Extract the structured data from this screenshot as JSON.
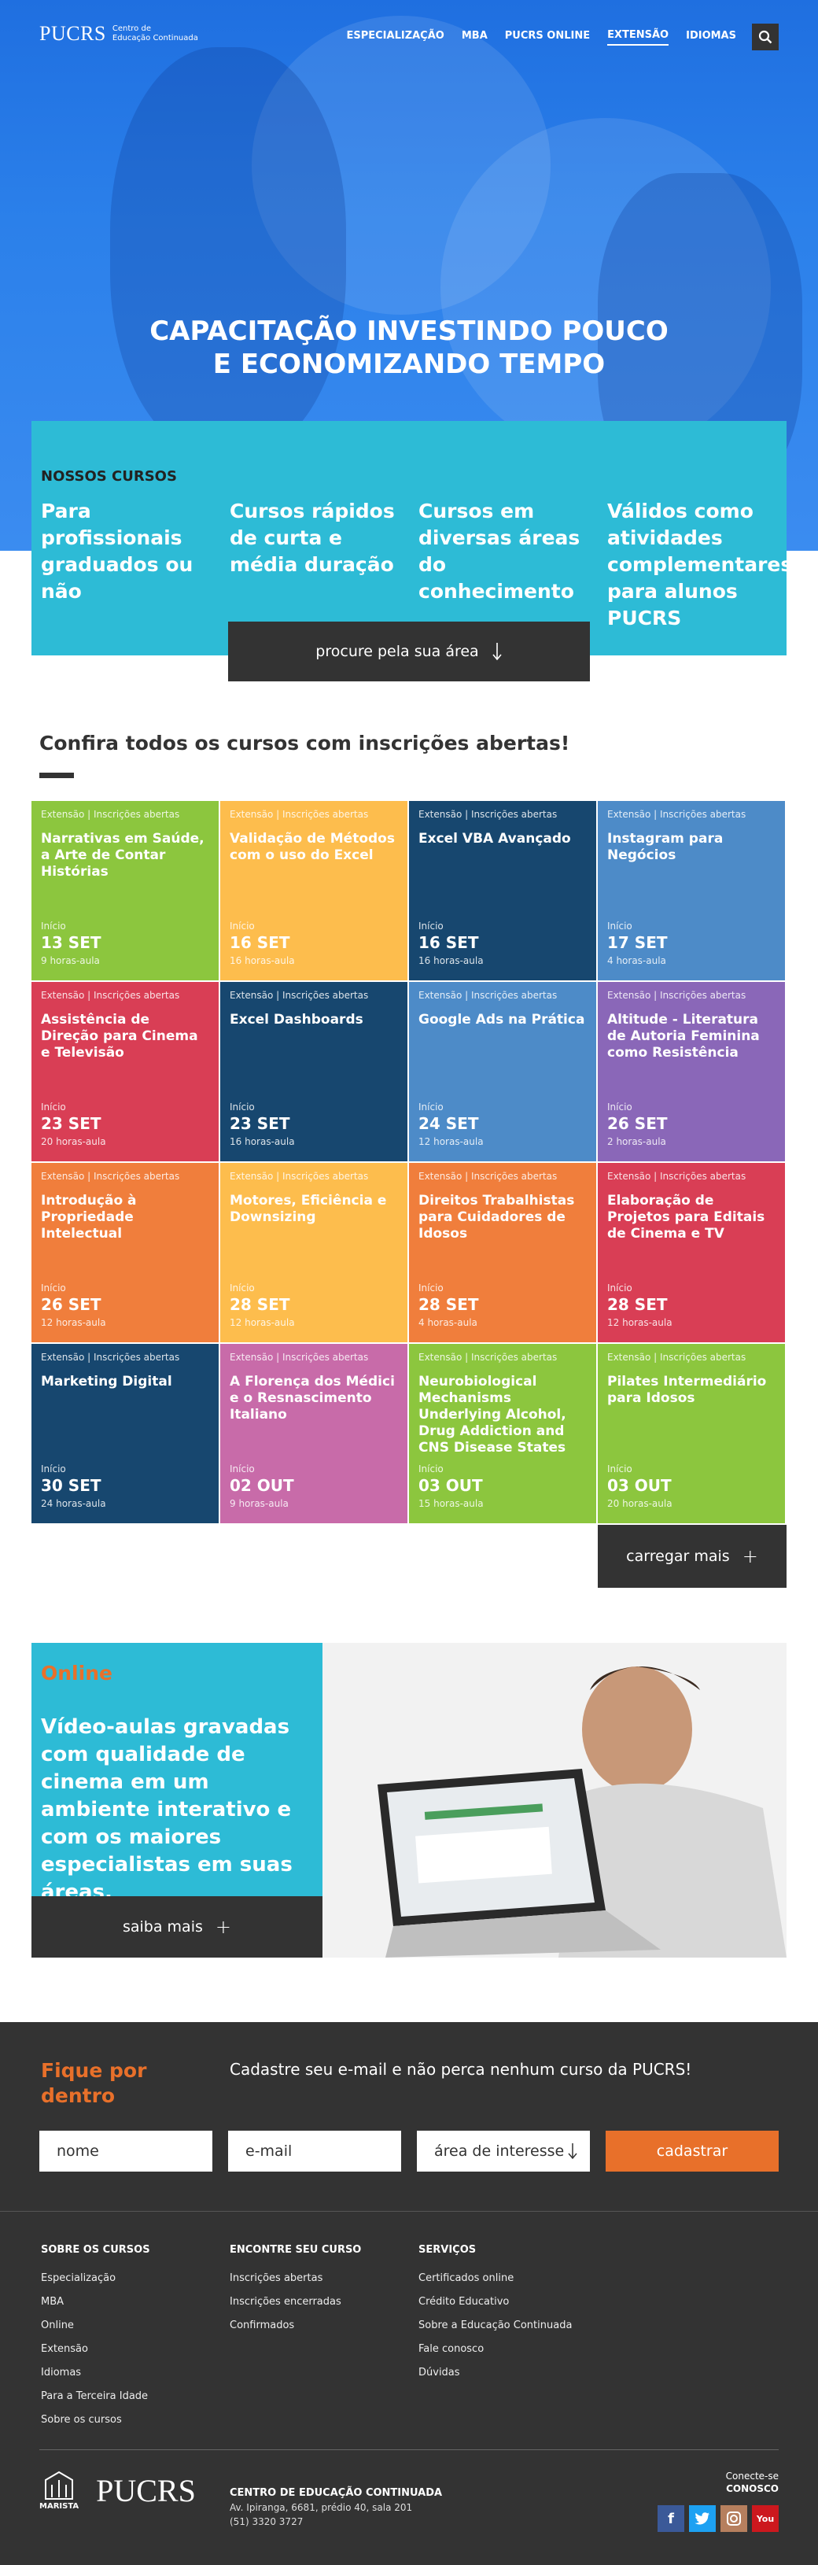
{
  "brand": {
    "name": "PUCRS",
    "sub1": "Centro de",
    "sub2": "Educação Continuada"
  },
  "nav": [
    "ESPECIALIZAÇÃO",
    "MBA",
    "PUCRS ONLINE",
    "EXTENSÃO",
    "IDIOMAS"
  ],
  "hero": {
    "line1": "CAPACITAÇÃO INVESTINDO POUCO",
    "line2": "E ECONOMIZANDO TEMPO"
  },
  "courses_box": {
    "label": "NOSSOS CURSOS",
    "columns": [
      "Para profissionais graduados ou não",
      "Cursos rápidos de curta e média duração",
      "Cursos em diversas áreas do conhecimento",
      "Válidos como atividades complementares para alunos PUCRS"
    ],
    "button": "procure pela sua área"
  },
  "section_title": "Confira todos os cursos com inscrições abertas!",
  "cards": [
    {
      "tag": "Extensão | Inscrições abertas",
      "title": "Narrativas em Saúde, a Arte de Contar Histórias",
      "inicio": "Início",
      "date": "13 SET",
      "hours": "9 horas-aula",
      "color": "#8cc63e"
    },
    {
      "tag": "Extensão | Inscrições abertas",
      "title": "Validação de Métodos com o uso do Excel",
      "inicio": "Início",
      "date": "16 SET",
      "hours": "16 horas-aula",
      "color": "#fdbd4d"
    },
    {
      "tag": "Extensão | Inscrições abertas",
      "title": "Excel VBA Avançado",
      "inicio": "Início",
      "date": "16 SET",
      "hours": "16 horas-aula",
      "color": "#17476f"
    },
    {
      "tag": "Extensão | Inscrições abertas",
      "title": "Instagram para Negócios",
      "inicio": "Início",
      "date": "17 SET",
      "hours": "4 horas-aula",
      "color": "#4d8bc8"
    },
    {
      "tag": "Extensão | Inscrições abertas",
      "title": "Assistência de Direção para Cinema e Televisão",
      "inicio": "Início",
      "date": "23 SET",
      "hours": "20 horas-aula",
      "color": "#d93e55"
    },
    {
      "tag": "Extensão | Inscrições abertas",
      "title": "Excel Dashboards",
      "inicio": "Início",
      "date": "23 SET",
      "hours": "16 horas-aula",
      "color": "#17476f"
    },
    {
      "tag": "Extensão | Inscrições abertas",
      "title": "Google Ads na Prática",
      "inicio": "Início",
      "date": "24 SET",
      "hours": "12 horas-aula",
      "color": "#4d8bc8"
    },
    {
      "tag": "Extensão | Inscrições abertas",
      "title": "Altitude - Literatura de Autoria Feminina como Resistência",
      "inicio": "Início",
      "date": "26 SET",
      "hours": "2 horas-aula",
      "color": "#8a67b8"
    },
    {
      "tag": "Extensão | Inscrições abertas",
      "title": "Introdução à Propriedade Intelectual",
      "inicio": "Início",
      "date": "26 SET",
      "hours": "12 horas-aula",
      "color": "#f07e3c"
    },
    {
      "tag": "Extensão | Inscrições abertas",
      "title": "Motores, Eficiência e Downsizing",
      "inicio": "Início",
      "date": "28 SET",
      "hours": "12 horas-aula",
      "color": "#fdbd4d"
    },
    {
      "tag": "Extensão | Inscrições abertas",
      "title": "Direitos Trabalhistas para Cuidadores de Idosos",
      "inicio": "Início",
      "date": "28 SET",
      "hours": "4 horas-aula",
      "color": "#f07e3c"
    },
    {
      "tag": "Extensão | Inscrições abertas",
      "title": "Elaboração de Projetos para Editais de Cinema e TV",
      "inicio": "Início",
      "date": "28 SET",
      "hours": "12 horas-aula",
      "color": "#d93e55"
    },
    {
      "tag": "Extensão | Inscrições abertas",
      "title": "Marketing Digital",
      "inicio": "Início",
      "date": "30 SET",
      "hours": "24 horas-aula",
      "color": "#17476f"
    },
    {
      "tag": "Extensão | Inscrições abertas",
      "title": "A Florença dos Médici e o Resnascimento Italiano",
      "inicio": "Início",
      "date": "02 OUT",
      "hours": "9 horas-aula",
      "color": "#c86ba9"
    },
    {
      "tag": "Extensão | Inscrições abertas",
      "title": "Neurobiological Mechanisms Underlying Alcohol, Drug Addiction and CNS Disease States",
      "inicio": "Início",
      "date": "03 OUT",
      "hours": "15 horas-aula",
      "color": "#8cc63e"
    },
    {
      "tag": "Extensão | Inscrições abertas",
      "title": "Pilates Intermediário para Idosos",
      "inicio": "Início",
      "date": "03 OUT",
      "hours": "20 horas-aula",
      "color": "#8cc63e"
    }
  ],
  "load_more": "carregar mais",
  "online": {
    "label": "Online",
    "text": "Vídeo-aulas gravadas com qualidade de cinema em um ambiente interativo e com os maiores especialistas em suas áreas.",
    "button": "saiba mais"
  },
  "newsletter": {
    "label1": "Fique por",
    "label2": "dentro",
    "desc": "Cadastre seu e-mail e não perca nenhum curso da PUCRS!",
    "name_ph": "nome",
    "email_ph": "e-mail",
    "area_ph": "área de interesse",
    "submit": "cadastrar"
  },
  "footer": {
    "col1": {
      "head": "SOBRE OS CURSOS",
      "items": [
        "Especialização",
        "MBA",
        "Online",
        "Extensão",
        "Idiomas",
        "Para a Terceira Idade",
        "Sobre os cursos"
      ]
    },
    "col2": {
      "head": "ENCONTRE SEU CURSO",
      "items": [
        "Inscrições abertas",
        "Inscrições encerradas",
        "Confirmados"
      ]
    },
    "col3": {
      "head": "SERVIÇOS",
      "items": [
        "Certificados online",
        "Crédito Educativo",
        "Sobre a Educação Continuada",
        "Fale conosco",
        "Dúvidas"
      ]
    },
    "marista": "MARISTA",
    "pucrs": "PUCRS",
    "addr_title": "CENTRO DE EDUCAÇÃO CONTINUADA",
    "addr1": "Av. Ipiranga, 6681, prédio 40, sala 201",
    "addr2": "(51) 3320 3727",
    "conecte": "Conecte-se",
    "conosco": "CONOSCO"
  }
}
